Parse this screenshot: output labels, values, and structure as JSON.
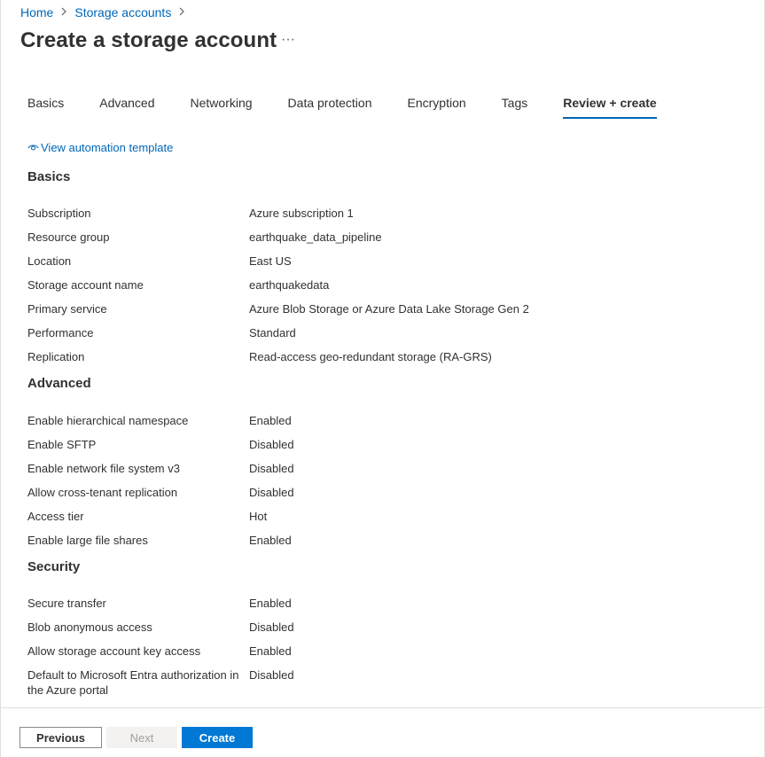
{
  "breadcrumb": {
    "items": [
      "Home",
      "Storage accounts"
    ]
  },
  "page": {
    "title": "Create a storage account",
    "more_label": "···"
  },
  "tabs": [
    {
      "label": "Basics",
      "active": false
    },
    {
      "label": "Advanced",
      "active": false
    },
    {
      "label": "Networking",
      "active": false
    },
    {
      "label": "Data protection",
      "active": false
    },
    {
      "label": "Encryption",
      "active": false
    },
    {
      "label": "Tags",
      "active": false
    },
    {
      "label": "Review + create",
      "active": true
    }
  ],
  "automation": {
    "label": "View automation template",
    "icon": "eye-icon"
  },
  "sections": {
    "basics": {
      "heading": "Basics",
      "rows": [
        {
          "key": "Subscription",
          "value": "Azure subscription 1"
        },
        {
          "key": "Resource group",
          "value": "earthquake_data_pipeline"
        },
        {
          "key": "Location",
          "value": "East US"
        },
        {
          "key": "Storage account name",
          "value": "earthquakedata"
        },
        {
          "key": "Primary service",
          "value": "Azure Blob Storage or Azure Data Lake Storage Gen 2"
        },
        {
          "key": "Performance",
          "value": "Standard"
        },
        {
          "key": "Replication",
          "value": "Read-access geo-redundant storage (RA-GRS)"
        }
      ]
    },
    "advanced": {
      "heading": "Advanced",
      "rows": [
        {
          "key": "Enable hierarchical namespace",
          "value": "Enabled"
        },
        {
          "key": "Enable SFTP",
          "value": "Disabled"
        },
        {
          "key": "Enable network file system v3",
          "value": "Disabled"
        },
        {
          "key": "Allow cross-tenant replication",
          "value": "Disabled"
        },
        {
          "key": "Access tier",
          "value": "Hot"
        },
        {
          "key": "Enable large file shares",
          "value": "Enabled"
        }
      ]
    },
    "security": {
      "heading": "Security",
      "rows": [
        {
          "key": "Secure transfer",
          "value": "Enabled"
        },
        {
          "key": "Blob anonymous access",
          "value": "Disabled"
        },
        {
          "key": "Allow storage account key access",
          "value": "Enabled"
        },
        {
          "key": "Default to Microsoft Entra authorization in the Azure portal",
          "value": "Disabled"
        }
      ]
    }
  },
  "footer": {
    "previous_label": "Previous",
    "next_label": "Next",
    "create_label": "Create"
  },
  "colors": {
    "accent": "#0078d4",
    "link": "#0067b8",
    "text": "#323130"
  }
}
